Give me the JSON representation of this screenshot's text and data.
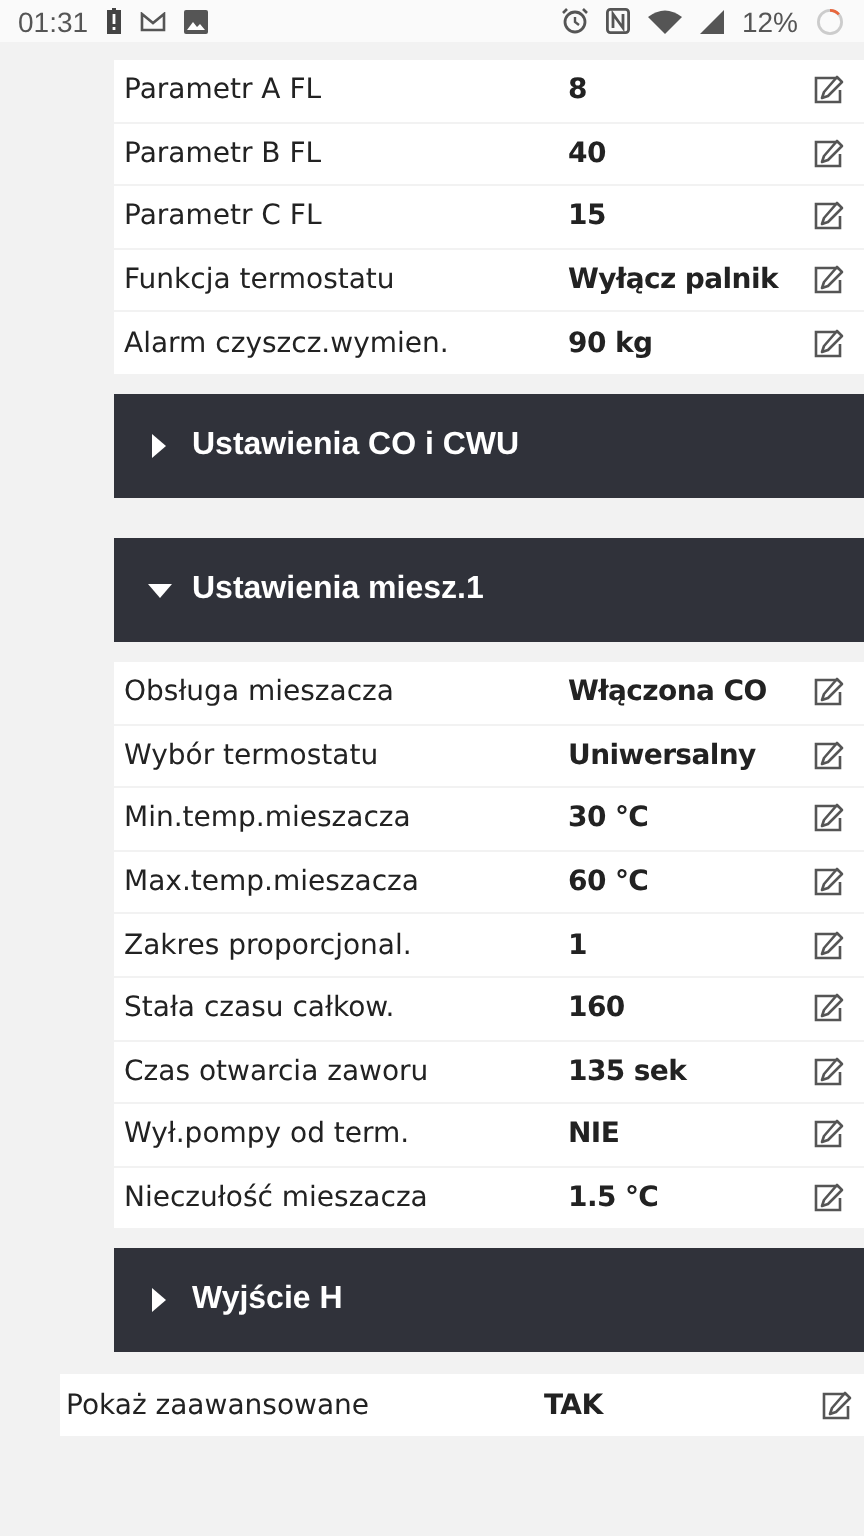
{
  "status_bar": {
    "time": "01:31",
    "battery": "12%"
  },
  "blocks": [
    {
      "kind": "rows",
      "rows": [
        {
          "label": "Parametr A FL",
          "value": "8"
        },
        {
          "label": "Parametr B FL",
          "value": "40"
        },
        {
          "label": "Parametr C FL",
          "value": "15"
        },
        {
          "label": "Funkcja termostatu",
          "value": "Wyłącz palnik"
        },
        {
          "label": "Alarm czyszcz.wymien.",
          "value": "90 kg"
        }
      ]
    },
    {
      "kind": "header",
      "title": "Ustawienia CO i CWU",
      "expanded": false
    },
    {
      "kind": "header",
      "title": "Ustawienia miesz.1",
      "expanded": true
    },
    {
      "kind": "rows",
      "rows": [
        {
          "label": "Obsługa mieszacza",
          "value": "Włączona CO"
        },
        {
          "label": "Wybór termostatu",
          "value": "Uniwersalny"
        },
        {
          "label": "Min.temp.mieszacza",
          "value": "30 °C"
        },
        {
          "label": "Max.temp.mieszacza",
          "value": "60 °C"
        },
        {
          "label": "Zakres proporcjonal.",
          "value": "1"
        },
        {
          "label": "Stała czasu całkow.",
          "value": "160"
        },
        {
          "label": "Czas otwarcia zaworu",
          "value": "135 sek"
        },
        {
          "label": "Wył.pompy od term.",
          "value": "NIE"
        },
        {
          "label": "Nieczułość mieszacza",
          "value": "1.5 °C"
        }
      ]
    },
    {
      "kind": "header",
      "title": "Wyjście H",
      "expanded": false
    }
  ],
  "advanced": {
    "label": "Pokaż zaawansowane",
    "value": "TAK"
  }
}
